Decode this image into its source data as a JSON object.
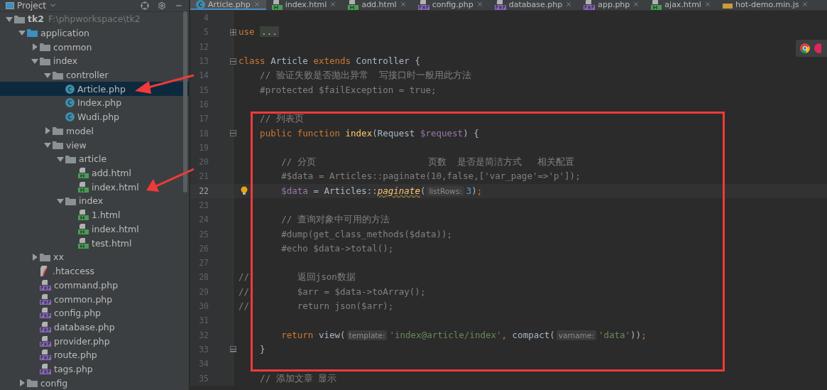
{
  "project_panel": {
    "title": "Project",
    "tree": [
      {
        "name": "tk2",
        "path": "F:\\phpworkspace\\tk2",
        "kind": "folder",
        "expanded": true,
        "selected": false,
        "children": [
          {
            "name": "application",
            "kind": "source-folder",
            "expanded": true,
            "selected": false,
            "children": [
              {
                "name": "common",
                "kind": "folder",
                "expanded": false,
                "selected": false
              },
              {
                "name": "index",
                "kind": "folder",
                "expanded": true,
                "selected": false,
                "children": [
                  {
                    "name": "controller",
                    "kind": "folder",
                    "expanded": true,
                    "selected": false,
                    "children": [
                      {
                        "name": "Article.php",
                        "kind": "class",
                        "selected": true
                      },
                      {
                        "name": "Index.php",
                        "kind": "class",
                        "selected": false
                      },
                      {
                        "name": "Wudi.php",
                        "kind": "class",
                        "selected": false
                      }
                    ]
                  },
                  {
                    "name": "model",
                    "kind": "folder",
                    "expanded": false,
                    "selected": false
                  },
                  {
                    "name": "view",
                    "kind": "folder",
                    "expanded": true,
                    "selected": false,
                    "children": [
                      {
                        "name": "article",
                        "kind": "folder",
                        "expanded": true,
                        "selected": false,
                        "children": [
                          {
                            "name": "add.html",
                            "kind": "html",
                            "selected": false
                          },
                          {
                            "name": "index.html",
                            "kind": "html",
                            "selected": false
                          }
                        ]
                      },
                      {
                        "name": "index",
                        "kind": "folder",
                        "expanded": true,
                        "selected": false,
                        "children": [
                          {
                            "name": "1.html",
                            "kind": "html",
                            "selected": false
                          },
                          {
                            "name": "index.html",
                            "kind": "html",
                            "selected": false
                          },
                          {
                            "name": "test.html",
                            "kind": "html",
                            "selected": false
                          }
                        ]
                      }
                    ]
                  }
                ]
              },
              {
                "name": "xx",
                "kind": "folder",
                "expanded": false,
                "selected": false
              },
              {
                "name": ".htaccess",
                "kind": "htaccess",
                "selected": false
              },
              {
                "name": "command.php",
                "kind": "php",
                "selected": false
              },
              {
                "name": "common.php",
                "kind": "php",
                "selected": false
              },
              {
                "name": "config.php",
                "kind": "php",
                "selected": false
              },
              {
                "name": "database.php",
                "kind": "php",
                "selected": false
              },
              {
                "name": "provider.php",
                "kind": "php",
                "selected": false
              },
              {
                "name": "route.php",
                "kind": "php",
                "selected": false
              },
              {
                "name": "tags.php",
                "kind": "php",
                "selected": false
              }
            ]
          },
          {
            "name": "config",
            "kind": "folder",
            "expanded": false,
            "selected": false
          }
        ]
      }
    ]
  },
  "tabs": [
    {
      "label": "Article.php",
      "kind": "class",
      "selected": true
    },
    {
      "label": "index.html",
      "kind": "html",
      "selected": false
    },
    {
      "label": "add.html",
      "kind": "html",
      "selected": false
    },
    {
      "label": "config.php",
      "kind": "php",
      "selected": false
    },
    {
      "label": "database.php",
      "kind": "php",
      "selected": false
    },
    {
      "label": "app.php",
      "kind": "php",
      "selected": false
    },
    {
      "label": "ajax.html",
      "kind": "html",
      "selected": false
    },
    {
      "label": "hot-demo.min.js",
      "kind": "js",
      "selected": false
    }
  ],
  "editor": {
    "lines": [
      {
        "number": "4",
        "current": false,
        "kind": "plain"
      },
      {
        "number": "5",
        "current": false,
        "kind": "folded",
        "tokens": [
          {
            "text": "use",
            "kind": "keyword"
          },
          {
            "text": " ...",
            "kind": "folded"
          }
        ]
      },
      {
        "number": "12",
        "current": false,
        "kind": "plain"
      },
      {
        "number": "13",
        "current": false,
        "kind": "fold-start",
        "tokens": [
          {
            "text": "class",
            "kind": "keyword"
          },
          {
            "text": " Article",
            "kind": "plain"
          },
          {
            "text": " extends",
            "kind": "keyword"
          },
          {
            "text": " Controller {",
            "kind": "plain"
          }
        ]
      },
      {
        "number": "14",
        "current": false,
        "kind": "plain",
        "tokens": [
          {
            "text": "    // 验证失败是否抛出异常  写接口时一般用此方法",
            "kind": "comment"
          }
        ]
      },
      {
        "number": "15",
        "current": false,
        "kind": "plain",
        "tokens": [
          {
            "text": "    #protected $failException = true;",
            "kind": "comment"
          }
        ]
      },
      {
        "number": "16",
        "current": false,
        "kind": "plain"
      },
      {
        "number": "17",
        "current": false,
        "kind": "plain",
        "tokens": [
          {
            "text": "    // 列表页",
            "kind": "comment"
          }
        ]
      },
      {
        "number": "18",
        "current": false,
        "kind": "fold-start",
        "tokens": [
          {
            "text": "    public function",
            "kind": "keyword"
          },
          {
            "text": " index",
            "kind": "function"
          },
          {
            "text": "(Request",
            "kind": "plain"
          },
          {
            "text": " $request",
            "kind": "variable"
          },
          {
            "text": ") {",
            "kind": "plain"
          }
        ]
      },
      {
        "number": "19",
        "current": false,
        "kind": "plain"
      },
      {
        "number": "20",
        "current": false,
        "kind": "plain",
        "tokens": [
          {
            "text": "        // 分页                     页数  是否是简洁方式   相关配置",
            "kind": "comment"
          }
        ]
      },
      {
        "number": "21",
        "current": false,
        "kind": "plain",
        "tokens": [
          {
            "text": "        #$data = Articles::paginate(10,false,['var_page'=>'p']);",
            "kind": "comment"
          }
        ]
      },
      {
        "number": "22",
        "current": true,
        "kind": "plain",
        "tokens": [
          {
            "text": "        $data",
            "kind": "variable"
          },
          {
            "text": " = Articles::",
            "kind": "plain"
          },
          {
            "text": "paginate",
            "kind": "static-call"
          },
          {
            "text": "(",
            "kind": "plain"
          },
          {
            "text": "listRows:",
            "kind": "hint"
          },
          {
            "text": "3",
            "kind": "number"
          },
          {
            "text": ")",
            "kind": "plain"
          },
          {
            "text": ";",
            "kind": "keyword"
          }
        ]
      },
      {
        "number": "23",
        "current": false,
        "kind": "plain"
      },
      {
        "number": "24",
        "current": false,
        "kind": "plain",
        "tokens": [
          {
            "text": "        // 查询对象中可用的方法",
            "kind": "comment"
          }
        ]
      },
      {
        "number": "25",
        "current": false,
        "kind": "plain",
        "tokens": [
          {
            "text": "        #dump(get_class_methods($data));",
            "kind": "comment"
          }
        ]
      },
      {
        "number": "26",
        "current": false,
        "kind": "plain",
        "tokens": [
          {
            "text": "        #echo $data->total();",
            "kind": "comment"
          }
        ]
      },
      {
        "number": "27",
        "current": false,
        "kind": "plain"
      },
      {
        "number": "28",
        "current": false,
        "kind": "plain",
        "tokens": [
          {
            "text": "//",
            "kind": "comment"
          },
          {
            "text": "         返回json数据",
            "kind": "comment"
          }
        ]
      },
      {
        "number": "29",
        "current": false,
        "kind": "plain",
        "tokens": [
          {
            "text": "//",
            "kind": "comment"
          },
          {
            "text": "         $arr = $data->toArray();",
            "kind": "comment"
          }
        ]
      },
      {
        "number": "30",
        "current": false,
        "kind": "plain",
        "tokens": [
          {
            "text": "//",
            "kind": "comment"
          },
          {
            "text": "         return json($arr);",
            "kind": "comment"
          }
        ]
      },
      {
        "number": "31",
        "current": false,
        "kind": "plain"
      },
      {
        "number": "32",
        "current": false,
        "kind": "plain",
        "tokens": [
          {
            "text": "        return",
            "kind": "keyword"
          },
          {
            "text": " view(",
            "kind": "plain"
          },
          {
            "text": "template:",
            "kind": "hint"
          },
          {
            "text": "'index@article/index'",
            "kind": "string"
          },
          {
            "text": ",",
            "kind": "keyword"
          },
          {
            "text": " compact(",
            "kind": "plain"
          },
          {
            "text": "varname:",
            "kind": "hint"
          },
          {
            "text": "'data'",
            "kind": "string"
          },
          {
            "text": "))",
            "kind": "plain"
          },
          {
            "text": ";",
            "kind": "keyword"
          }
        ]
      },
      {
        "number": "33",
        "current": false,
        "kind": "fold-end",
        "tokens": [
          {
            "text": "    }",
            "kind": "plain"
          }
        ]
      },
      {
        "number": "34",
        "current": false,
        "kind": "plain"
      },
      {
        "number": "35",
        "current": false,
        "kind": "plain",
        "tokens": [
          {
            "text": "    // 添加文章 显示",
            "kind": "comment"
          }
        ]
      }
    ]
  }
}
